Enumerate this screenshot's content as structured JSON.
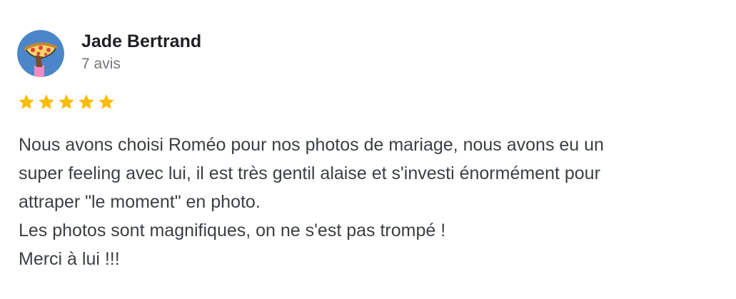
{
  "reviewer": {
    "name": "Jade Bertrand",
    "review_count": "7 avis",
    "avatar_icon": "pizza-avatar-icon"
  },
  "rating": {
    "stars": 5,
    "max": 5,
    "star_color": "#fbbc04",
    "star_icon": "star-icon"
  },
  "review": {
    "lines": [
      "Nous avons choisi Roméo pour nos photos de mariage, nous avons eu un",
      "super feeling avec lui, il est très gentil alaise et s'investi énormément pour",
      "attraper \"le moment\" en photo.",
      "Les photos sont magnifiques, on ne s'est pas trompé !",
      "Merci à lui !!!"
    ]
  },
  "colors": {
    "avatar_background": "#4a86c8",
    "name_text": "#202124",
    "meta_text": "#70757a",
    "body_text": "#3c4043"
  }
}
